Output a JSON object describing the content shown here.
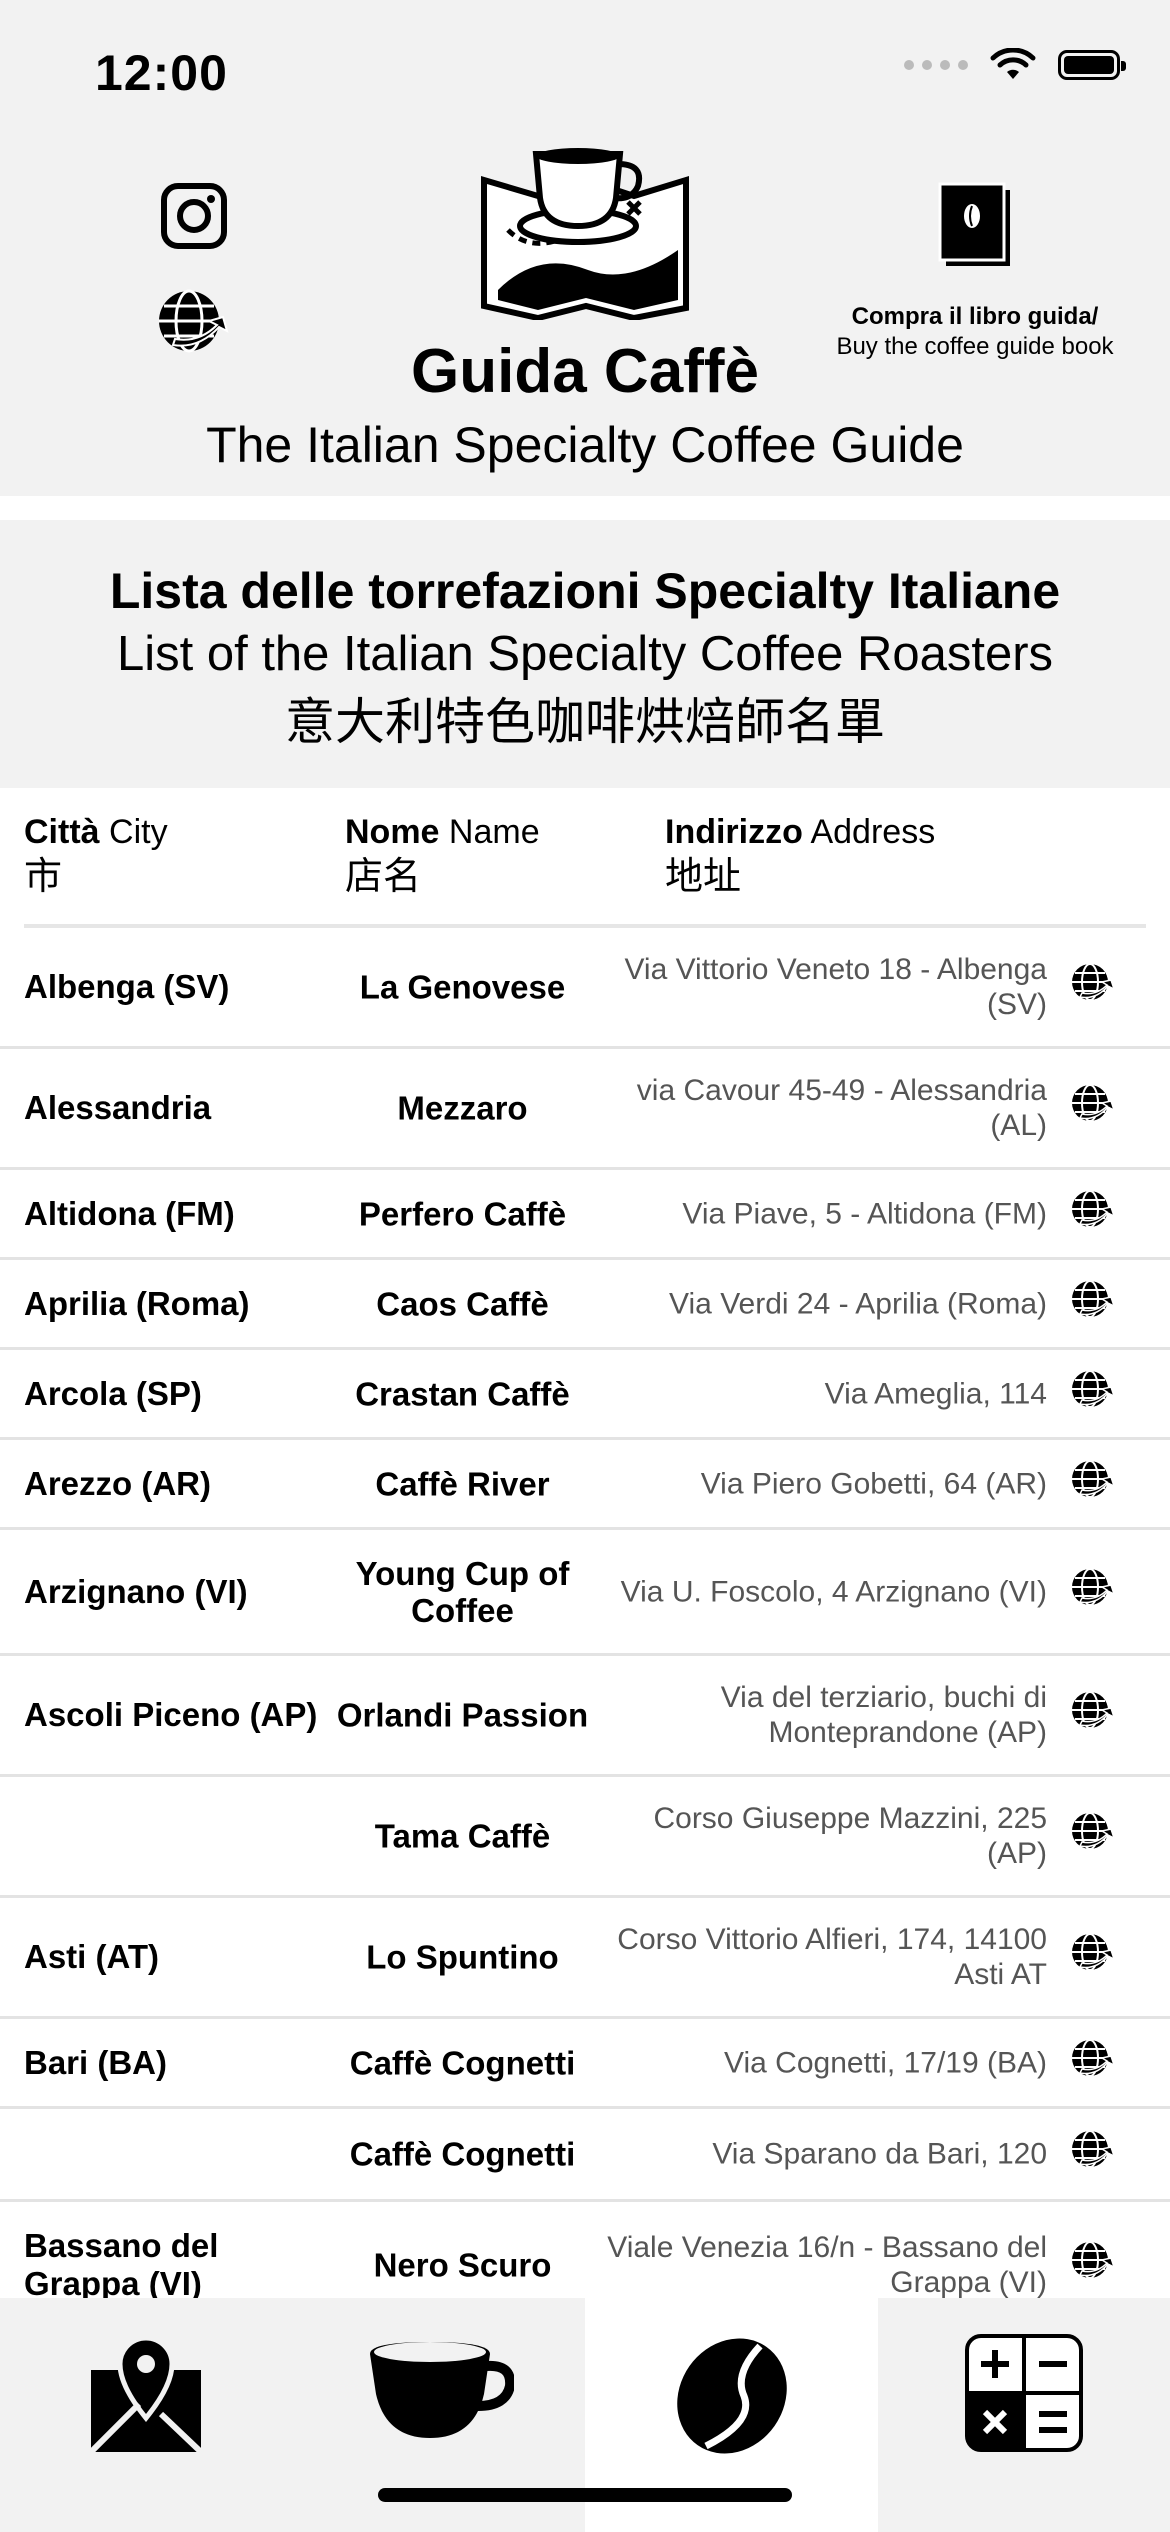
{
  "status": {
    "time": "12:00"
  },
  "header": {
    "title": "Guida Caffè",
    "subtitle": "The Italian Specialty Coffee Guide",
    "book_label_it": "Compra il libro guida/",
    "book_label_en": "Buy the coffee guide book"
  },
  "list_title": {
    "it": "Lista delle torrefazioni Specialty Italiane",
    "en": "List of the Italian Specialty Coffee Roasters",
    "zh": "意大利特色咖啡烘焙師名單"
  },
  "columns": [
    {
      "bold": "Città",
      "en": "City",
      "zh": "市"
    },
    {
      "bold": "Nome",
      "en": "Name",
      "zh": "店名"
    },
    {
      "bold": "Indirizzo",
      "en": "Address",
      "zh": "地址"
    }
  ],
  "rows": [
    {
      "city": "Albenga (SV)",
      "name": "La Genovese",
      "address": "Via Vittorio Veneto 18 - Albenga (SV)"
    },
    {
      "city": "Alessandria",
      "name": "Mezzaro",
      "address": "via Cavour 45-49 - Alessandria (AL)"
    },
    {
      "city": "Altidona (FM)",
      "name": "Perfero Caffè",
      "address": "Via Piave, 5 - Altidona (FM)"
    },
    {
      "city": "Aprilia (Roma)",
      "name": "Caos Caffè",
      "address": "Via Verdi 24 - Aprilia (Roma)"
    },
    {
      "city": "Arcola (SP)",
      "name": "Crastan Caffè",
      "address": "Via Ameglia, 114"
    },
    {
      "city": "Arezzo (AR)",
      "name": "Caffè River",
      "address": "Via Piero Gobetti, 64 (AR)"
    },
    {
      "city": "Arzignano (VI)",
      "name": "Young Cup of Coffee",
      "address": "Via U. Foscolo, 4 Arzignano (VI)"
    },
    {
      "city": "Ascoli Piceno (AP)",
      "name": "Orlandi Passion",
      "address": "Via del terziario, buchi di Monteprandone  (AP)"
    },
    {
      "city": "",
      "name": "Tama Caffè",
      "address": "Corso Giuseppe Mazzini, 225 (AP)"
    },
    {
      "city": "Asti (AT)",
      "name": "Lo Spuntino",
      "address": "Corso Vittorio Alfieri, 174, 14100 Asti AT"
    },
    {
      "city": "Bari (BA)",
      "name": "Caffè Cognetti",
      "address": "Via Cognetti, 17/19 (BA)"
    },
    {
      "city": "",
      "name": "Caffè Cognetti",
      "address": "Via Sparano da Bari, 120"
    },
    {
      "city": "Bassano del Grappa (VI)",
      "name": "Nero Scuro",
      "address": "Viale Venezia 16/n - Bassano del Grappa (VI)"
    }
  ],
  "tabs": [
    {
      "icon": "map-icon"
    },
    {
      "icon": "coffee-cup-icon"
    },
    {
      "icon": "coffee-bean-icon",
      "selected": true
    },
    {
      "icon": "calculator-icon"
    }
  ]
}
